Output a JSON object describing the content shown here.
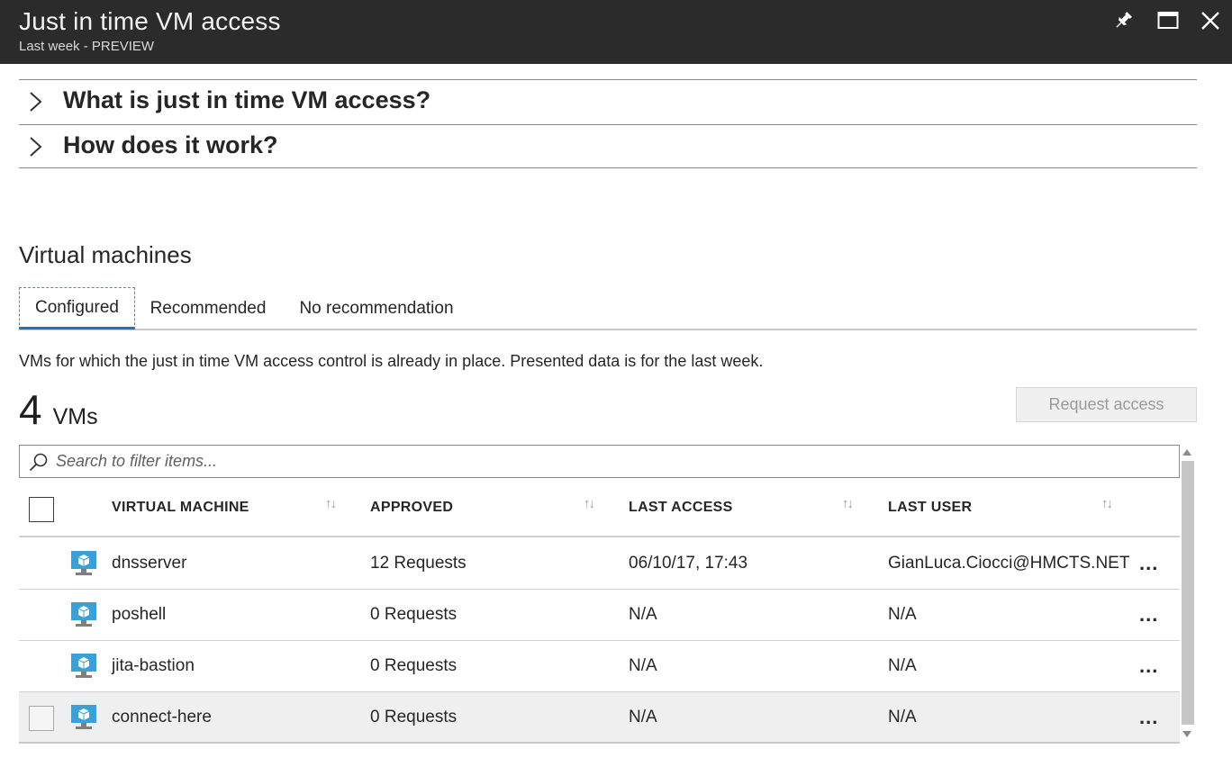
{
  "window": {
    "title": "Just in time VM access",
    "subtitle": "Last week - PREVIEW",
    "icons": [
      "pin-icon",
      "maximize-icon",
      "close-icon"
    ]
  },
  "accordions": [
    {
      "label": "What is just in time VM access?"
    },
    {
      "label": "How does it work?"
    }
  ],
  "section": {
    "title": "Virtual machines"
  },
  "tabs": [
    {
      "label": "Configured",
      "selected": true
    },
    {
      "label": "Recommended",
      "selected": false
    },
    {
      "label": "No recommendation",
      "selected": false
    }
  ],
  "description": "VMs for which the just in time VM access control is already in place. Presented data is for the last week.",
  "summary": {
    "count": "4",
    "unit": "VMs"
  },
  "request_button": {
    "label": "Request access",
    "enabled": false
  },
  "search": {
    "placeholder": "Search to filter items...",
    "value": ""
  },
  "table": {
    "columns": [
      "VIRTUAL MACHINE",
      "APPROVED",
      "LAST ACCESS",
      "LAST USER"
    ],
    "rows": [
      {
        "vm": "dnsserver",
        "approved": "12 Requests",
        "last_access": "06/10/17, 17:43",
        "last_user": "GianLuca.Ciocci@HMCTS.NET",
        "more": "..."
      },
      {
        "vm": "poshell",
        "approved": "0 Requests",
        "last_access": "N/A",
        "last_user": "N/A",
        "more": "..."
      },
      {
        "vm": "jita-bastion",
        "approved": "0 Requests",
        "last_access": "N/A",
        "last_user": "N/A",
        "more": "..."
      },
      {
        "vm": "connect-here",
        "approved": "0 Requests",
        "last_access": "N/A",
        "last_user": "N/A",
        "more": "..."
      }
    ]
  },
  "colors": {
    "titlebar_bg": "#2b2b2b",
    "accent": "#2a6ebb",
    "vm_icon": "#3aa0d8",
    "disabled_text": "#9a9a9a"
  }
}
